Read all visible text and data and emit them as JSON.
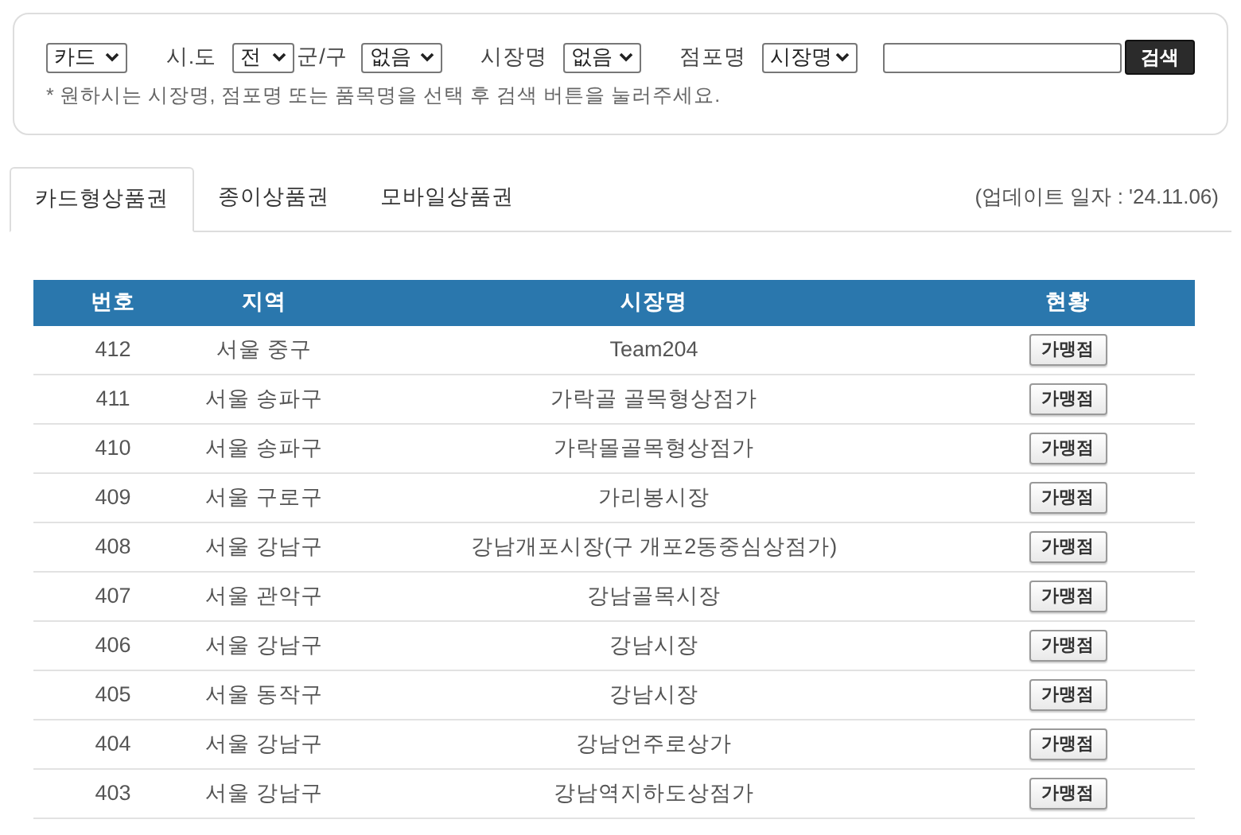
{
  "filters": [
    {
      "kind": "select",
      "value": "카드"
    },
    {
      "kind": "select",
      "label": "시.도",
      "value": "전"
    },
    {
      "kind": "select",
      "label": "군/구",
      "value": "없음"
    },
    {
      "kind": "select",
      "label": "시장명",
      "value": "없음"
    },
    {
      "kind": "select",
      "label": "점포명",
      "value": "시장명"
    },
    {
      "kind": "input"
    }
  ],
  "search_button": "검색",
  "hint": "* 원하시는 시장명, 점포명 또는 품목명을 선택 후 검색 버튼을 눌러주세요.",
  "tabs": [
    {
      "label": "카드형상품권",
      "selected": true
    },
    {
      "label": "종이상품권",
      "selected": false
    },
    {
      "label": "모바일상품권",
      "selected": false
    }
  ],
  "update_note": "(업데이트 일자 : '24.11.06)",
  "table": {
    "columns": [
      "번호",
      "지역",
      "시장명",
      "현황"
    ],
    "rows": [
      {
        "no": "412",
        "region": "서울 중구",
        "market": "Team204",
        "action": "가맹점"
      },
      {
        "no": "411",
        "region": "서울 송파구",
        "market": "가락골 골목형상점가",
        "action": "가맹점"
      },
      {
        "no": "410",
        "region": "서울 송파구",
        "market": "가락몰골목형상점가",
        "action": "가맹점"
      },
      {
        "no": "409",
        "region": "서울 구로구",
        "market": "가리봉시장",
        "action": "가맹점"
      },
      {
        "no": "408",
        "region": "서울 강남구",
        "market": "강남개포시장(구 개포2동중심상점가)",
        "action": "가맹점"
      },
      {
        "no": "407",
        "region": "서울 관악구",
        "market": "강남골목시장",
        "action": "가맹점"
      },
      {
        "no": "406",
        "region": "서울 강남구",
        "market": "강남시장",
        "action": "가맹점"
      },
      {
        "no": "405",
        "region": "서울 동작구",
        "market": "강남시장",
        "action": "가맹점"
      },
      {
        "no": "404",
        "region": "서울 강남구",
        "market": "강남언주로상가",
        "action": "가맹점"
      },
      {
        "no": "403",
        "region": "서울 강남구",
        "market": "강남역지하도상점가",
        "action": "가맹점"
      }
    ]
  }
}
